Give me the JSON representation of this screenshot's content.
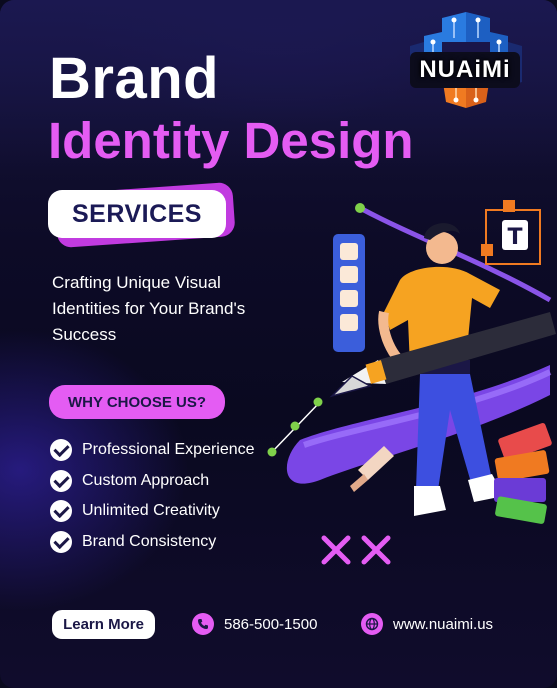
{
  "brand": {
    "logo_text": "NUAiMi"
  },
  "headline": {
    "line1": "Brand",
    "line2": "Identity Design"
  },
  "badge": {
    "label": "SERVICES"
  },
  "tagline": "Crafting Unique Visual Identities for Your Brand's Success",
  "why": {
    "label": "WHY CHOOSE US?"
  },
  "features": [
    {
      "label": "Professional Experience"
    },
    {
      "label": "Custom Approach"
    },
    {
      "label": "Unlimited Creativity"
    },
    {
      "label": "Brand Consistency"
    }
  ],
  "cta": {
    "label": "Learn More"
  },
  "contact": {
    "phone": "586-500-1500",
    "website": "www.nuaimi.us"
  },
  "icons": [
    "check-icon",
    "phone-icon",
    "globe-icon",
    "pen-tool-icon",
    "text-tool-icon",
    "cursor-icon"
  ],
  "colors": {
    "accent": "#e45cf3",
    "background": "#0d0b27",
    "navy": "#1b1746",
    "text": "#ffffff"
  }
}
